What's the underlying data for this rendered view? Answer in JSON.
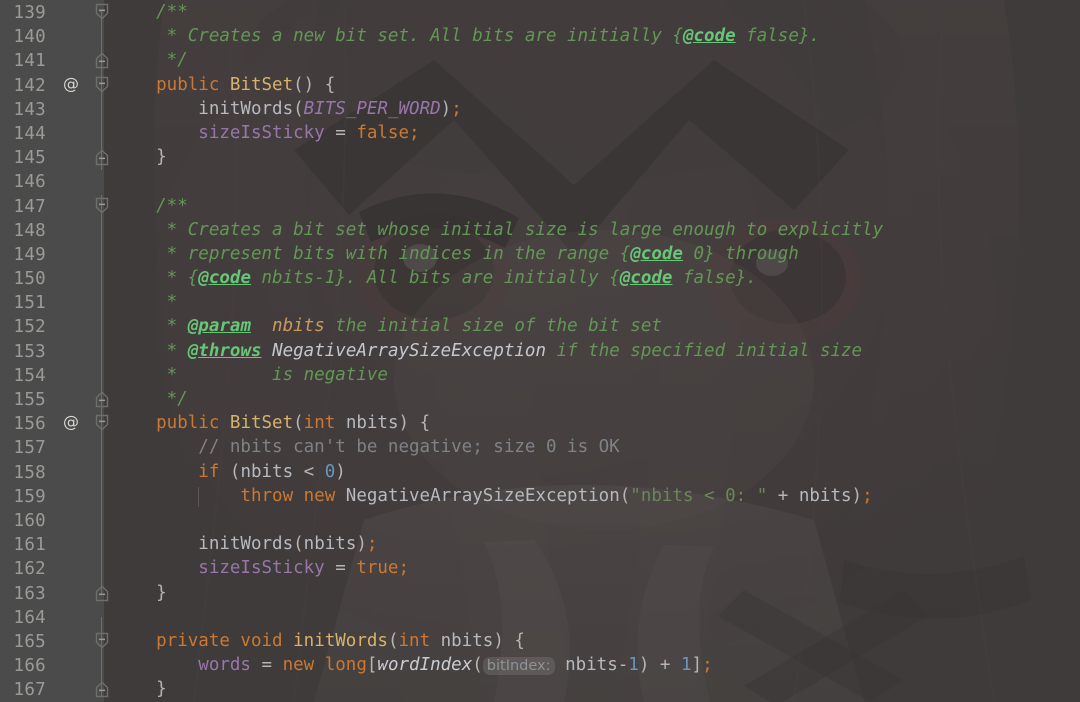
{
  "app": {
    "name": "intellij-idea-editor",
    "file_language": "java",
    "first_visible_line": 139,
    "last_visible_line": 167
  },
  "theme": {
    "editor_background": "#454342",
    "gutter_background": "#4b4b4b",
    "line_number_color": "#9a9a96",
    "default_text": "#b6b6b0",
    "keyword": "#cc7832",
    "class_name": "#d8b26a",
    "field": "#9876aa",
    "number": "#6897bb",
    "string": "#6a8759",
    "line_comment": "#7f8287",
    "javadoc_text": "#629755",
    "javadoc_tag": "#67c777",
    "javadoc_param_name": "#cc9a5f",
    "inlay_hint_text": "#8f9296",
    "fold_marker": "#6e6e6c"
  },
  "gutter": {
    "annotation_icon_name": "at-annotation-icon",
    "annotation_glyph": "@",
    "annotated_lines": [
      142,
      156
    ],
    "fold_start_lines": [
      139,
      142,
      147,
      156,
      165
    ],
    "fold_end_lines": [
      141,
      145,
      155,
      163,
      167
    ]
  },
  "lines": [
    {
      "no": "139",
      "tokens": [
        {
          "t": "doc",
          "v": "    /**"
        }
      ]
    },
    {
      "no": "140",
      "tokens": [
        {
          "t": "doc",
          "v": "     * Creates a new bit set. All bits are initially {"
        },
        {
          "t": "doctag",
          "v": "@code"
        },
        {
          "t": "doc",
          "v": " false}."
        }
      ]
    },
    {
      "no": "141",
      "tokens": [
        {
          "t": "doc",
          "v": "     */"
        }
      ]
    },
    {
      "no": "142",
      "tokens": [
        {
          "t": "kw",
          "v": "    public "
        },
        {
          "t": "type",
          "v": "BitSet"
        },
        {
          "t": "punct",
          "v": "() {"
        }
      ]
    },
    {
      "no": "143",
      "tokens": [
        {
          "t": "method",
          "v": "        initWords"
        },
        {
          "t": "punct",
          "v": "("
        },
        {
          "t": "sfield",
          "v": "BITS_PER_WORD"
        },
        {
          "t": "punct",
          "v": ")"
        },
        {
          "t": "semi",
          "v": ";"
        }
      ]
    },
    {
      "no": "144",
      "tokens": [
        {
          "t": "field",
          "v": "        sizeIsSticky"
        },
        {
          "t": "punct",
          "v": " = "
        },
        {
          "t": "kw",
          "v": "false"
        },
        {
          "t": "semi",
          "v": ";"
        }
      ]
    },
    {
      "no": "145",
      "tokens": [
        {
          "t": "punct",
          "v": "    }"
        }
      ]
    },
    {
      "no": "146",
      "tokens": []
    },
    {
      "no": "147",
      "tokens": [
        {
          "t": "doc",
          "v": "    /**"
        }
      ]
    },
    {
      "no": "148",
      "tokens": [
        {
          "t": "doc",
          "v": "     * Creates a bit set whose initial size is large enough to explicitly"
        }
      ]
    },
    {
      "no": "149",
      "tokens": [
        {
          "t": "doc",
          "v": "     * represent bits with indices in the range {"
        },
        {
          "t": "doctag",
          "v": "@code"
        },
        {
          "t": "doc",
          "v": " 0} through"
        }
      ]
    },
    {
      "no": "150",
      "tokens": [
        {
          "t": "doc",
          "v": "     * {"
        },
        {
          "t": "doctag",
          "v": "@code"
        },
        {
          "t": "doc",
          "v": " nbits-1}. All bits are initially {"
        },
        {
          "t": "doctag",
          "v": "@code"
        },
        {
          "t": "doc",
          "v": " false}."
        }
      ]
    },
    {
      "no": "151",
      "tokens": [
        {
          "t": "doc",
          "v": "     *"
        }
      ]
    },
    {
      "no": "152",
      "tokens": [
        {
          "t": "doc",
          "v": "     * "
        },
        {
          "t": "doctag",
          "v": "@param"
        },
        {
          "t": "docparam",
          "v": "  nbits"
        },
        {
          "t": "doc",
          "v": " the initial size of the bit set"
        }
      ]
    },
    {
      "no": "153",
      "tokens": [
        {
          "t": "doc",
          "v": "     * "
        },
        {
          "t": "doctag",
          "v": "@throws"
        },
        {
          "t": "docval",
          "v": " NegativeArraySizeException"
        },
        {
          "t": "doc",
          "v": " if the specified initial size"
        }
      ]
    },
    {
      "no": "154",
      "tokens": [
        {
          "t": "doc",
          "v": "     *         is negative"
        }
      ]
    },
    {
      "no": "155",
      "tokens": [
        {
          "t": "doc",
          "v": "     */"
        }
      ]
    },
    {
      "no": "156",
      "tokens": [
        {
          "t": "kw",
          "v": "    public "
        },
        {
          "t": "type",
          "v": "BitSet"
        },
        {
          "t": "punct",
          "v": "("
        },
        {
          "t": "kw",
          "v": "int"
        },
        {
          "t": "ident",
          "v": " nbits"
        },
        {
          "t": "punct",
          "v": ") {"
        }
      ]
    },
    {
      "no": "157",
      "tokens": [
        {
          "t": "cmt",
          "v": "        // nbits can't be negative; size 0 is OK"
        }
      ]
    },
    {
      "no": "158",
      "tokens": [
        {
          "t": "kw",
          "v": "        if "
        },
        {
          "t": "punct",
          "v": "("
        },
        {
          "t": "ident",
          "v": "nbits"
        },
        {
          "t": "punct",
          "v": " < "
        },
        {
          "t": "num",
          "v": "0"
        },
        {
          "t": "punct",
          "v": ")"
        }
      ]
    },
    {
      "no": "159",
      "tokens": [
        {
          "t": "kw",
          "v": "            throw new "
        },
        {
          "t": "ident",
          "v": "NegativeArraySizeException"
        },
        {
          "t": "punct",
          "v": "("
        },
        {
          "t": "str",
          "v": "\"nbits < 0: \""
        },
        {
          "t": "punct",
          "v": " + "
        },
        {
          "t": "ident",
          "v": "nbits"
        },
        {
          "t": "punct",
          "v": ")"
        },
        {
          "t": "semi",
          "v": ";"
        }
      ]
    },
    {
      "no": "160",
      "tokens": []
    },
    {
      "no": "161",
      "tokens": [
        {
          "t": "method",
          "v": "        initWords"
        },
        {
          "t": "punct",
          "v": "("
        },
        {
          "t": "ident",
          "v": "nbits"
        },
        {
          "t": "punct",
          "v": ")"
        },
        {
          "t": "semi",
          "v": ";"
        }
      ]
    },
    {
      "no": "162",
      "tokens": [
        {
          "t": "field",
          "v": "        sizeIsSticky"
        },
        {
          "t": "punct",
          "v": " = "
        },
        {
          "t": "kw",
          "v": "true"
        },
        {
          "t": "semi",
          "v": ";"
        }
      ]
    },
    {
      "no": "163",
      "tokens": [
        {
          "t": "punct",
          "v": "    }"
        }
      ]
    },
    {
      "no": "164",
      "tokens": []
    },
    {
      "no": "165",
      "tokens": [
        {
          "t": "kw",
          "v": "    private void "
        },
        {
          "t": "type",
          "v": "initWords"
        },
        {
          "t": "punct",
          "v": "("
        },
        {
          "t": "kw",
          "v": "int"
        },
        {
          "t": "ident",
          "v": " nbits"
        },
        {
          "t": "punct",
          "v": ") {"
        }
      ]
    },
    {
      "no": "166",
      "tokens": [
        {
          "t": "field",
          "v": "        words"
        },
        {
          "t": "punct",
          "v": " = "
        },
        {
          "t": "kw",
          "v": "new long"
        },
        {
          "t": "punct",
          "v": "["
        },
        {
          "t": "methodi",
          "v": "wordIndex"
        },
        {
          "t": "punct",
          "v": "("
        },
        {
          "t": "hint",
          "v": "bitIndex:"
        },
        {
          "t": "ident",
          "v": " nbits-"
        },
        {
          "t": "num",
          "v": "1"
        },
        {
          "t": "punct",
          "v": ") + "
        },
        {
          "t": "num",
          "v": "1"
        },
        {
          "t": "punct",
          "v": "]"
        },
        {
          "t": "semi",
          "v": ";"
        }
      ]
    },
    {
      "no": "167",
      "tokens": [
        {
          "t": "punct",
          "v": "    }"
        }
      ]
    }
  ],
  "inlay_hints": [
    {
      "line": 166,
      "label": "bitIndex:"
    }
  ],
  "indent_guides": [
    {
      "line": 159,
      "indent_level": 2
    }
  ]
}
